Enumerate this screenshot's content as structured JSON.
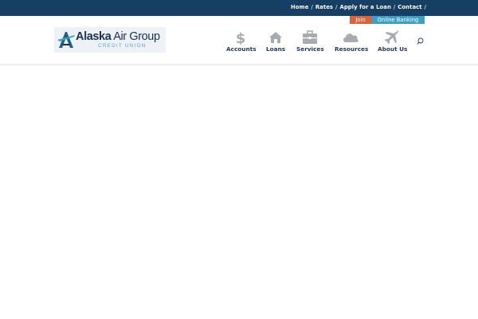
{
  "topbar": {
    "links": [
      "Home",
      "Rates",
      "Apply for a Loan",
      "Contact"
    ],
    "separator": "/"
  },
  "buttons": {
    "join": "Join",
    "online_banking": "Online Banking"
  },
  "logo": {
    "title_bold": "Alaska",
    "title_rest": " Air Group",
    "subtitle": "CREDIT UNION"
  },
  "nav": {
    "items": [
      {
        "label": "Accounts",
        "icon": "dollar-icon"
      },
      {
        "label": "Loans",
        "icon": "house-icon"
      },
      {
        "label": "Services",
        "icon": "briefcase-icon"
      },
      {
        "label": "Resources",
        "icon": "cloud-icon"
      },
      {
        "label": "About Us",
        "icon": "airplane-icon"
      }
    ]
  },
  "colors": {
    "topbar": "#173f63",
    "join": "#d9643b",
    "online_banking": "#3e9fc1",
    "nav_icon": "#a8acb1",
    "nav_text": "#233a5a"
  }
}
